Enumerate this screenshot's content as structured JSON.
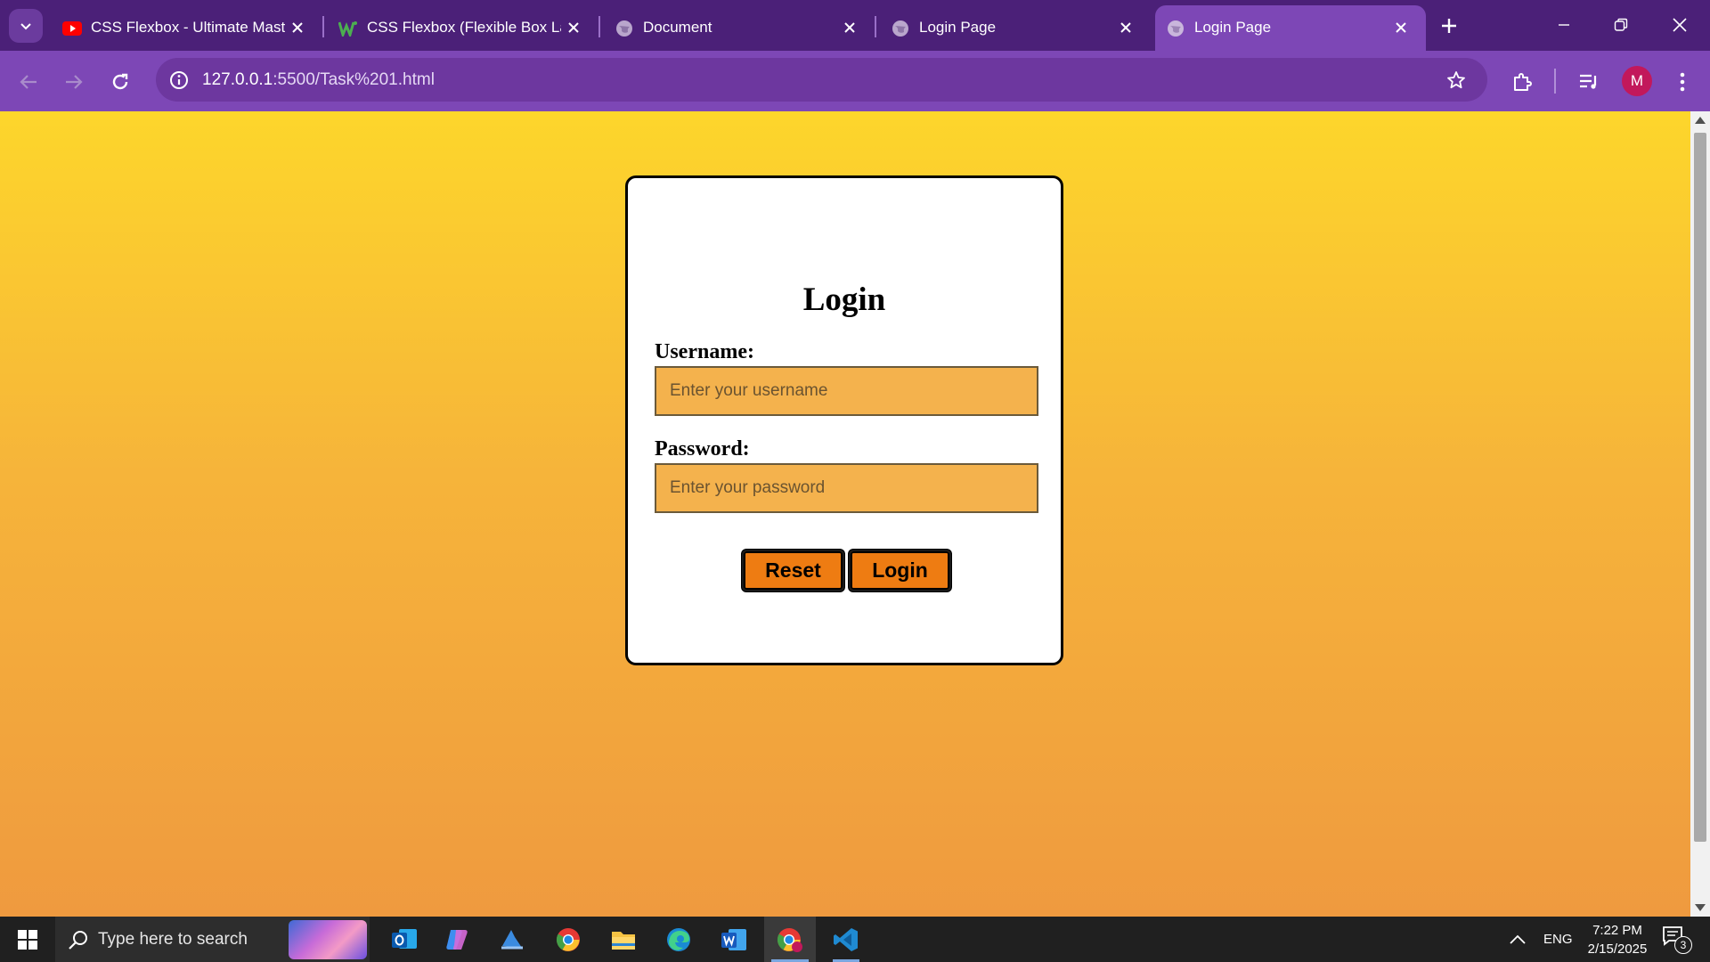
{
  "browser": {
    "tabs": [
      {
        "title": "CSS Flexbox - Ultimate Mastery",
        "favicon": "youtube-icon"
      },
      {
        "title": "CSS Flexbox (Flexible Box Layout)",
        "favicon": "w3schools-icon"
      },
      {
        "title": "Document",
        "favicon": "globe-icon"
      },
      {
        "title": "Login Page",
        "favicon": "globe-icon"
      },
      {
        "title": "Login Page",
        "favicon": "globe-icon",
        "active": true
      }
    ],
    "url_host": "127.0.0.1",
    "url_path": ":5500/Task%201.html",
    "profile_initial": "M",
    "colors": {
      "frame": "#4b2078",
      "toolbar": "#7d47b6",
      "omnibox": "#6d379f"
    }
  },
  "page": {
    "heading": "Login",
    "username_label": "Username:",
    "username_placeholder": "Enter your username",
    "password_label": "Password:",
    "password_placeholder": "Enter your password",
    "reset_label": "Reset",
    "login_label": "Login",
    "colors": {
      "gradient_top": "#fdd62b",
      "gradient_bottom": "#ef9a3f",
      "field": "#f4b24d",
      "button": "#ee7c12"
    }
  },
  "taskbar": {
    "search_placeholder": "Type here to search",
    "apps": [
      "outlook-icon",
      "copilot-icon",
      "azure-icon",
      "chrome-icon",
      "file-explorer-icon",
      "edge-icon",
      "word-icon",
      "chrome-profile-icon",
      "vscode-icon"
    ],
    "language": "ENG",
    "time": "7:22 PM",
    "date": "2/15/2025",
    "notifications": "3"
  }
}
